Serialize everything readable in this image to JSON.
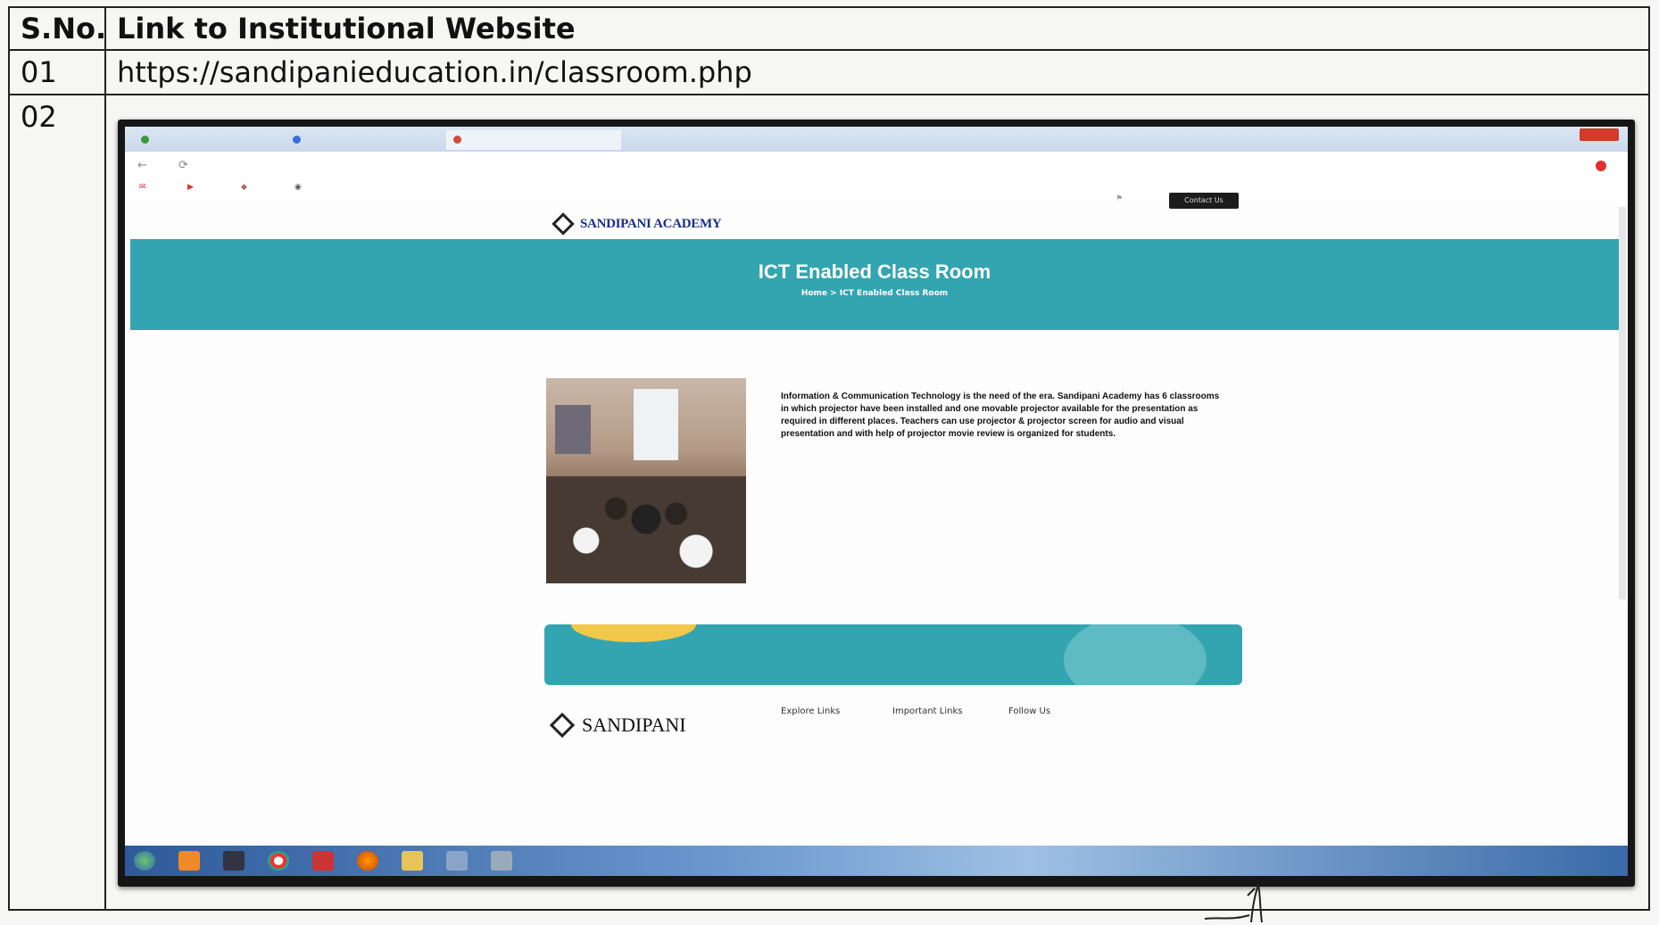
{
  "table": {
    "header_sno": "S.No.",
    "header_link": "Link to Institutional Website",
    "rows": [
      {
        "sno": "01",
        "link": "https://sandipanieducation.in/classroom.php"
      },
      {
        "sno": "02",
        "link": ""
      }
    ]
  },
  "screenshot": {
    "contact_button": "Contact Us",
    "logo_text": "SANDIPANI ACADEMY",
    "banner_title": "ICT Enabled Class Room",
    "breadcrumb": "Home  >  ICT Enabled Class Room",
    "paragraph1": "Information & Communication Technology is the need of the era. Sandipani Academy has 6 classrooms in which projector have been installed and one movable projector available for the presentation as required in different places. Teachers can use projector & projector screen for audio and visual presentation and with help of projector movie review is organized for students.",
    "footer_logo": "SANDIPANI",
    "footer_columns": [
      "Explore Links",
      "Important Links",
      "Follow Us"
    ],
    "colors": {
      "banner": "#33a5b1",
      "taskbar": "#2e5a9a"
    }
  }
}
